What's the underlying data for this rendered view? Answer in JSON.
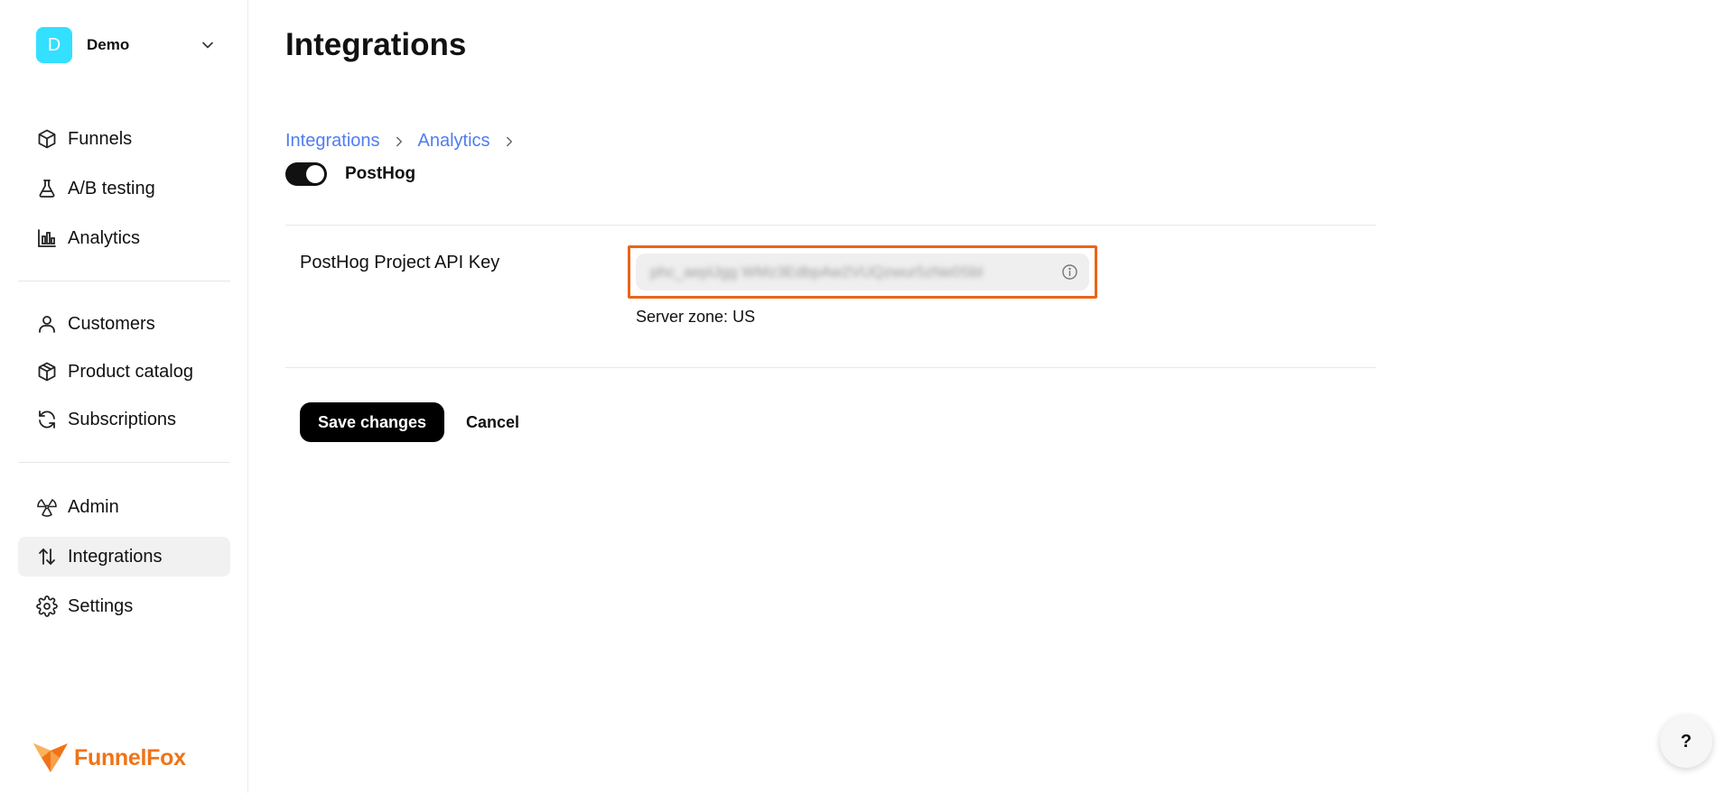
{
  "workspace": {
    "initial": "D",
    "name": "Demo",
    "avatar_color": "#33e0ff",
    "chevron_icon": "chevron-down-icon"
  },
  "sidebar": {
    "items": [
      {
        "label": "Funnels",
        "icon": "cube-icon",
        "active": false
      },
      {
        "label": "A/B testing",
        "icon": "flask-icon",
        "active": false
      },
      {
        "label": "Analytics",
        "icon": "bar-chart-icon",
        "active": false
      },
      {
        "label": "Customers",
        "icon": "user-icon",
        "active": false
      },
      {
        "label": "Product catalog",
        "icon": "box-icon",
        "active": false
      },
      {
        "label": "Subscriptions",
        "icon": "refresh-icon",
        "active": false
      },
      {
        "label": "Admin",
        "icon": "radiation-icon",
        "active": false
      },
      {
        "label": "Integrations",
        "icon": "arrows-up-down-icon",
        "active": true
      },
      {
        "label": "Settings",
        "icon": "gear-icon",
        "active": false
      }
    ]
  },
  "brand": {
    "name": "FunnelFox",
    "color": "#f07316"
  },
  "main": {
    "title": "Integrations",
    "breadcrumb": [
      "Integrations",
      "Analytics"
    ],
    "provider": {
      "name": "PostHog",
      "enabled": true
    },
    "field": {
      "label": "PostHog Project API Key",
      "value": "phc_aeplJgg WMz3EdbpAw2VUQzwur5zNe0Sbl",
      "highlight_color": "#e8651a"
    },
    "server_zone": {
      "label": "Server zone:",
      "value": "US"
    },
    "actions": {
      "save_label": "Save changes",
      "cancel_label": "Cancel"
    }
  },
  "help": {
    "label": "?"
  },
  "colors": {
    "link": "#4f7cf1",
    "active_nav_bg": "#f1f1f1"
  }
}
